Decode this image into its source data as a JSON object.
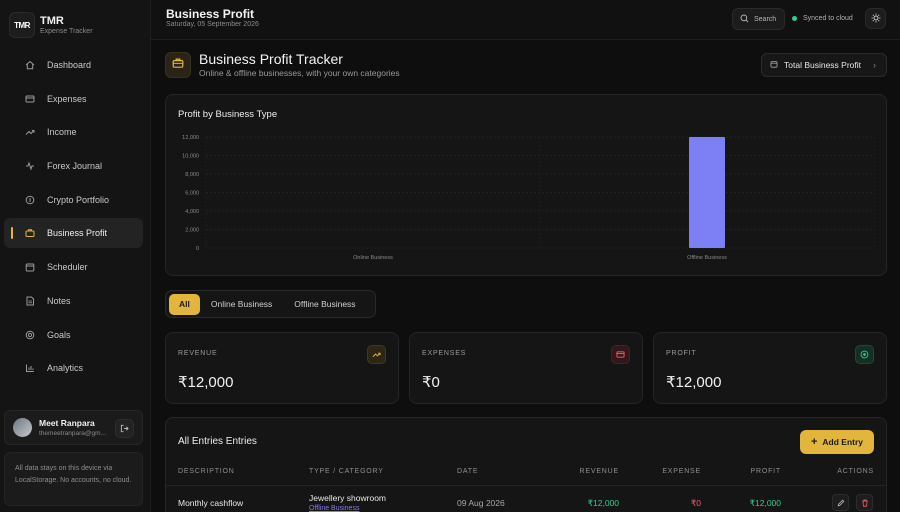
{
  "brand": {
    "logo": "TMR",
    "title": "TMR",
    "subtitle": "Expense Tracker"
  },
  "sidebar": {
    "items": [
      {
        "label": "Dashboard",
        "icon": "home-icon"
      },
      {
        "label": "Expenses",
        "icon": "card-icon"
      },
      {
        "label": "Income",
        "icon": "trend-up-icon"
      },
      {
        "label": "Forex Journal",
        "icon": "pulse-icon"
      },
      {
        "label": "Crypto Portfolio",
        "icon": "coin-icon"
      },
      {
        "label": "Business Profit",
        "icon": "briefcase-icon",
        "active": true
      },
      {
        "label": "Scheduler",
        "icon": "calendar-icon"
      },
      {
        "label": "Notes",
        "icon": "note-icon"
      },
      {
        "label": "Goals",
        "icon": "target-icon"
      },
      {
        "label": "Analytics",
        "icon": "bar-chart-icon"
      }
    ],
    "user": {
      "name": "Meet Ranpara",
      "email": "themeetranpara@gm..."
    },
    "storage_note": "All data stays on this device via LocalStorage. No accounts, no cloud."
  },
  "topbar": {
    "title": "Business Profit",
    "date": "Saturday, 05 September 2026",
    "search_label": "Search",
    "sync_label": "Synced to cloud"
  },
  "header": {
    "title": "Business Profit Tracker",
    "subtitle": "Online & offline businesses, with your own categories",
    "total_button": "Total Business Profit"
  },
  "chart_data": {
    "type": "bar",
    "title": "Profit by Business Type",
    "categories": [
      "Online Business",
      "Offline Business"
    ],
    "values": [
      0,
      12000
    ],
    "ylim": [
      0,
      12000
    ],
    "yticks": [
      "12,000",
      "10,000",
      "8,000",
      "6,000",
      "4,000",
      "2,000",
      "0"
    ],
    "bar_color": "#7d7ff5",
    "grid": true
  },
  "tabs": [
    {
      "label": "All",
      "active": true
    },
    {
      "label": "Online Business",
      "active": false
    },
    {
      "label": "Offline Business",
      "active": false
    }
  ],
  "stats": [
    {
      "label": "REVENUE",
      "value": "₹12,000",
      "color": "#e2b53c"
    },
    {
      "label": "EXPENSES",
      "value": "₹0",
      "color": "#f0606a"
    },
    {
      "label": "PROFIT",
      "value": "₹12,000",
      "color": "#2fd08b"
    }
  ],
  "entries": {
    "title": "All Entries Entries",
    "add_button": "Add Entry",
    "columns": [
      "DESCRIPTION",
      "TYPE / CATEGORY",
      "DATE",
      "REVENUE",
      "EXPENSE",
      "PROFIT",
      "ACTIONS"
    ],
    "rows": [
      {
        "description": "Monthly cashflow",
        "type": "Jewellery showroom",
        "category": "Offline Business",
        "date": "09 Aug 2026",
        "revenue": "₹12,000",
        "expense": "₹0",
        "profit": "₹12,000"
      }
    ]
  }
}
